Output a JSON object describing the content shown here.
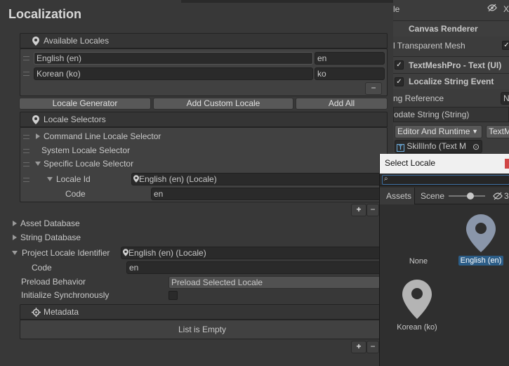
{
  "header": {
    "title": "Localization"
  },
  "available_locales": {
    "title": "Available Locales",
    "rows": [
      {
        "name": "English (en)",
        "code": "en"
      },
      {
        "name": "Korean (ko)",
        "code": "ko"
      }
    ],
    "remove": "−"
  },
  "buttons": {
    "generator": "Locale Generator",
    "add_custom": "Add Custom Locale",
    "add_all": "Add All"
  },
  "selectors": {
    "title": "Locale Selectors",
    "cmd": "Command Line Locale Selector",
    "system": "System Locale Selector",
    "specific": "Specific Locale Selector",
    "locale_id_label": "Locale Id",
    "locale_id_value": "English (en) (Locale)",
    "code_label": "Code",
    "code_value": "en",
    "plus": "+",
    "minus": "−"
  },
  "settings": {
    "asset_db": "Asset Database",
    "string_db": "String Database",
    "project_locale_label": "Project Locale Identifier",
    "project_locale_value": "English (en) (Locale)",
    "code_label": "Code",
    "code_value": "en",
    "preload_label": "Preload Behavior",
    "preload_value": "Preload Selected Locale",
    "init_sync_label": "Initialize Synchronously"
  },
  "metadata": {
    "title": "Metadata",
    "empty": "List is Empty",
    "plus": "+",
    "minus": "−"
  },
  "inspector": {
    "tab_fragment": "le",
    "canvas_renderer": "Canvas Renderer",
    "transparent_mesh": "l Transparent Mesh",
    "tmp": "TextMeshPro - Text (UI)",
    "localize_event": "Localize String Event",
    "string_ref": "ng Reference",
    "update_string": "odate String (String)",
    "editor_runtime": "Editor And Runtime",
    "text_fragment": "TextM",
    "skillinfo": "SkillInfo (Text M",
    "n_label": "N",
    "x_label": "X"
  },
  "popup": {
    "title": "Select Locale",
    "search_icon_text": "⌕",
    "tabs": {
      "assets": "Assets",
      "scene": "Scene"
    },
    "hidden_count": "3",
    "items": [
      {
        "label": "None"
      },
      {
        "label": "English (en)"
      },
      {
        "label": "Korean (ko)"
      }
    ]
  },
  "colors": {
    "accent": "#2d5b8c",
    "selected": "#2c5d87"
  }
}
